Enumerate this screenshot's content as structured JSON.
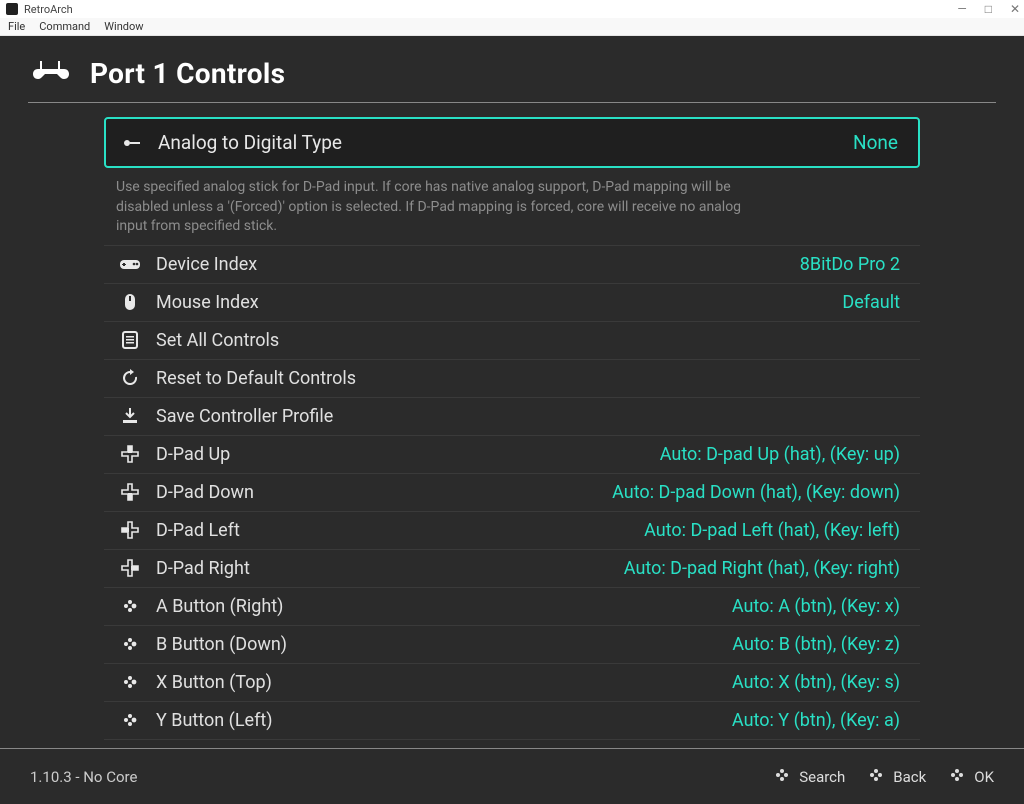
{
  "window": {
    "app_name": "RetroArch",
    "menus": [
      "File",
      "Command",
      "Window"
    ]
  },
  "header": {
    "title": "Port 1 Controls"
  },
  "selected": {
    "label": "Analog to Digital Type",
    "value": "None",
    "help": "Use specified analog stick for D-Pad input. If core has native analog support, D-Pad mapping will be disabled unless a '(Forced)' option is selected. If D-Pad mapping is forced, core will receive no analog input from specified stick."
  },
  "rows": [
    {
      "icon": "gamepad-icon",
      "label": "Device Index",
      "value": "8BitDo Pro 2"
    },
    {
      "icon": "mouse-icon",
      "label": "Mouse Index",
      "value": "Default"
    },
    {
      "icon": "list-icon",
      "label": "Set All Controls",
      "value": ""
    },
    {
      "icon": "reset-icon",
      "label": "Reset to Default Controls",
      "value": ""
    },
    {
      "icon": "save-icon",
      "label": "Save Controller Profile",
      "value": ""
    },
    {
      "icon": "dpad-up-icon",
      "label": "D-Pad Up",
      "value": "Auto:  D-pad Up (hat), (Key: up)"
    },
    {
      "icon": "dpad-down-icon",
      "label": "D-Pad Down",
      "value": "Auto:  D-pad Down (hat), (Key: down)"
    },
    {
      "icon": "dpad-left-icon",
      "label": "D-Pad Left",
      "value": "Auto:  D-pad Left (hat), (Key: left)"
    },
    {
      "icon": "dpad-right-icon",
      "label": "D-Pad Right",
      "value": "Auto:  D-pad Right (hat), (Key: right)"
    },
    {
      "icon": "face-btn-icon",
      "label": "A Button (Right)",
      "value": "Auto:  A (btn), (Key: x)"
    },
    {
      "icon": "face-btn-icon",
      "label": "B Button (Down)",
      "value": "Auto:  B (btn), (Key: z)"
    },
    {
      "icon": "face-btn-icon",
      "label": "X Button (Top)",
      "value": "Auto:  X (btn), (Key: s)"
    },
    {
      "icon": "face-btn-icon",
      "label": "Y Button (Left)",
      "value": "Auto:  Y (btn), (Key: a)"
    }
  ],
  "footer": {
    "version": "1.10.3 - No Core",
    "actions": [
      {
        "label": "Search"
      },
      {
        "label": "Back"
      },
      {
        "label": "OK"
      }
    ]
  }
}
